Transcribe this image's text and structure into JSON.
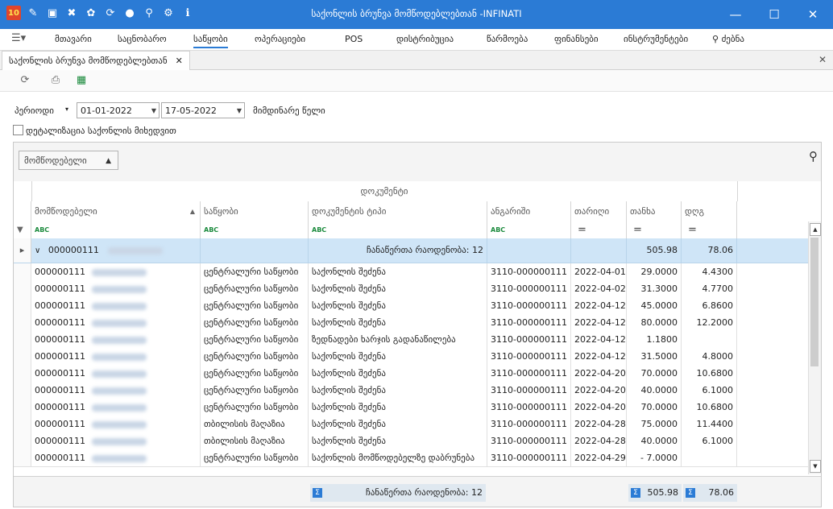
{
  "window": {
    "title": "საქონლის ბრუნვა მომწოდებლებთან -INFINATI",
    "logo_text": "10",
    "accent": "#2b7bd5",
    "controls": {
      "minimize": "—",
      "maximize": "☐",
      "close": "✕"
    },
    "quick_icons": [
      "pencil-icon",
      "save-icon",
      "tools-icon",
      "palette-icon",
      "refresh-icon",
      "user-icon",
      "search-icon",
      "settings-icon",
      "info-icon"
    ]
  },
  "menu": {
    "items": [
      "მთავარი",
      "საცნობარო",
      "საწყობი",
      "ოპერაციები",
      "POS",
      "დისტრიბუცია",
      "წარმოება",
      "ფინანსები",
      "ინსტრუმენტები"
    ],
    "active": "საწყობი",
    "search_label": "ძებნა"
  },
  "tab": {
    "label": "საქონლის ბრუნვა მომწოდებლებთან",
    "close": "✕",
    "strip_close": "✕"
  },
  "filters": {
    "period_label": "პერიოდი",
    "date_from": "01-01-2022",
    "date_to": "17-05-2022",
    "period_name": "მიმდინარე წელი",
    "detail_label": "დეტალიზაცია საქონლის მიხედვით"
  },
  "grid": {
    "group_chip": "მომწოდებელი",
    "band_label": "დოკუმენტი",
    "columns": [
      "მომწოდებელი",
      "საწყობი",
      "დოკუმენტის ტიპი",
      "ანგარიში",
      "თარიღი",
      "თანხა",
      "დღგ"
    ],
    "filter_glyph": "ABC",
    "eq_glyph": "=",
    "group_row": {
      "code": "000000111",
      "count_label": "ჩანაწერთა რაოდენობა: 12",
      "amount": "505.98",
      "vat": "78.06"
    },
    "rows": [
      {
        "supplier": "000000111",
        "warehouse": "ცენტრალური საწყობი",
        "doc_type": "საქონლის შეძენა",
        "account": "3110-000000111",
        "date": "2022-04-01",
        "amount": "29.0000",
        "vat": "4.4300"
      },
      {
        "supplier": "000000111",
        "warehouse": "ცენტრალური საწყობი",
        "doc_type": "საქონლის შეძენა",
        "account": "3110-000000111",
        "date": "2022-04-02",
        "amount": "31.3000",
        "vat": "4.7700"
      },
      {
        "supplier": "000000111",
        "warehouse": "ცენტრალური საწყობი",
        "doc_type": "საქონლის შეძენა",
        "account": "3110-000000111",
        "date": "2022-04-12",
        "amount": "45.0000",
        "vat": "6.8600"
      },
      {
        "supplier": "000000111",
        "warehouse": "ცენტრალური საწყობი",
        "doc_type": "საქონლის შეძენა",
        "account": "3110-000000111",
        "date": "2022-04-12",
        "amount": "80.0000",
        "vat": "12.2000"
      },
      {
        "supplier": "000000111",
        "warehouse": "ცენტრალური საწყობი",
        "doc_type": "ზედნადები ხარჯის გადანაწილება",
        "account": "3110-000000111",
        "date": "2022-04-12",
        "amount": "1.1800",
        "vat": ""
      },
      {
        "supplier": "000000111",
        "warehouse": "ცენტრალური საწყობი",
        "doc_type": "საქონლის შეძენა",
        "account": "3110-000000111",
        "date": "2022-04-12",
        "amount": "31.5000",
        "vat": "4.8000"
      },
      {
        "supplier": "000000111",
        "warehouse": "ცენტრალური საწყობი",
        "doc_type": "საქონლის შეძენა",
        "account": "3110-000000111",
        "date": "2022-04-20",
        "amount": "70.0000",
        "vat": "10.6800"
      },
      {
        "supplier": "000000111",
        "warehouse": "ცენტრალური საწყობი",
        "doc_type": "საქონლის შეძენა",
        "account": "3110-000000111",
        "date": "2022-04-20",
        "amount": "40.0000",
        "vat": "6.1000"
      },
      {
        "supplier": "000000111",
        "warehouse": "ცენტრალური საწყობი",
        "doc_type": "საქონლის შეძენა",
        "account": "3110-000000111",
        "date": "2022-04-20",
        "amount": "70.0000",
        "vat": "10.6800"
      },
      {
        "supplier": "000000111",
        "warehouse": "თბილისის მაღაზია",
        "doc_type": "საქონლის შეძენა",
        "account": "3110-000000111",
        "date": "2022-04-28",
        "amount": "75.0000",
        "vat": "11.4400"
      },
      {
        "supplier": "000000111",
        "warehouse": "თბილისის მაღაზია",
        "doc_type": "საქონლის შეძენა",
        "account": "3110-000000111",
        "date": "2022-04-28",
        "amount": "40.0000",
        "vat": "6.1000"
      },
      {
        "supplier": "000000111",
        "warehouse": "ცენტრალური საწყობი",
        "doc_type": "საქონლის მომწოდებელზე დაბრუნება",
        "account": "3110-000000111",
        "date": "2022-04-29",
        "amount": "-   7.0000",
        "vat": ""
      }
    ],
    "footer": {
      "count_label": "ჩანაწერთა რაოდენობა: 12",
      "amount": "505.98",
      "vat": "78.06"
    }
  }
}
